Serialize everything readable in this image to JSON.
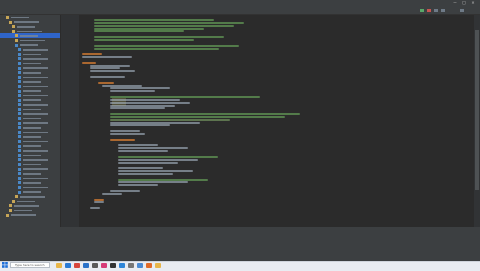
{
  "window": {
    "title": "",
    "controls": [
      "—",
      "□",
      "✕"
    ]
  },
  "sidebar": {
    "rows": 44
  },
  "editor": {
    "line_count": 74
  },
  "taskbar": {
    "search_placeholder": "Type here to search",
    "apps": [
      "file-explorer",
      "edge",
      "chrome",
      "mail",
      "store",
      "intellij",
      "terminal",
      "photos",
      "settings",
      "notepad",
      "music",
      "explorer2"
    ]
  },
  "colors": {
    "editor_bg": "#2b2b2b",
    "panel_bg": "#3c3f41",
    "comment": "#629755",
    "keyword": "#cc7832",
    "identifier": "#a9b7c6",
    "selection": "#2f65ca"
  }
}
